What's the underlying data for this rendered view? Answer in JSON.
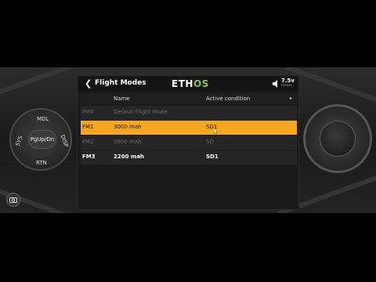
{
  "device": {
    "nav_dial": {
      "top": "MDL",
      "left": "SYS",
      "right": "DISP",
      "bottom": "RTN",
      "center": "PgUp/Dn"
    }
  },
  "screen": {
    "title": "Flight Modes",
    "logo_main": "ETH",
    "logo_accent": "OS",
    "battery": {
      "voltage": "7.5v",
      "sub": "ETHOS"
    },
    "columns": {
      "name": "Name",
      "condition": "Active condition"
    },
    "rows": [
      {
        "id": "FM0",
        "name": "Default Flight Mode",
        "condition": "",
        "state": "dim"
      },
      {
        "id": "FM1",
        "name": "3000 mah",
        "condition": "SD1",
        "state": "selected"
      },
      {
        "id": "FM2",
        "name": "2800 mah",
        "condition": "SD",
        "state": "dim"
      },
      {
        "id": "FM3",
        "name": "2200 mah",
        "condition": "SD1",
        "state": "normal"
      }
    ]
  },
  "colors": {
    "accent": "#f5a623",
    "logo_green": "#8ac43f"
  },
  "icons": [
    "back-arrow-icon",
    "speaker-icon",
    "sort-arrow-icon",
    "camera-icon",
    "cursor-icon"
  ]
}
